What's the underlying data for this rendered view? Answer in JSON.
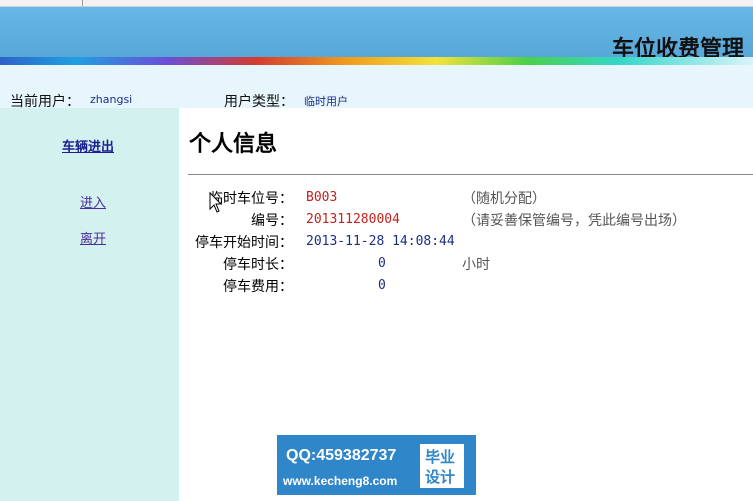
{
  "header": {
    "title": "车位收费管理"
  },
  "userbar": {
    "current_user_label": "当前用户：",
    "current_user": "zhangsi",
    "user_type_label": "用户类型：",
    "user_type": "临时用户"
  },
  "sidebar": {
    "heading": "车辆进出",
    "items": [
      {
        "label": "进入"
      },
      {
        "label": "离开"
      }
    ]
  },
  "main": {
    "title": "个人信息",
    "fields": [
      {
        "label": "临时车位号：",
        "value": "B003",
        "note": "（随机分配）"
      },
      {
        "label": "编号：",
        "value": "201311280004",
        "note": "（请妥善保管编号，凭此编号出场）"
      },
      {
        "label": "停车开始时间：",
        "value": "2013-11-28 14:08:44"
      },
      {
        "label": "停车时长：",
        "value": "0",
        "note": "小时"
      },
      {
        "label": "停车费用：",
        "value": "0"
      }
    ]
  },
  "watermark": {
    "qq": "QQ:459382737",
    "url": "www.kecheng8.com",
    "badge_line1": "毕业",
    "badge_line2": "设计"
  },
  "colors": {
    "header": "#5fb0e0",
    "sidebar": "#d2f1ef",
    "userbar": "#e7f5fd",
    "value_red": "#c0241d",
    "value_blue": "#1b2e86"
  }
}
